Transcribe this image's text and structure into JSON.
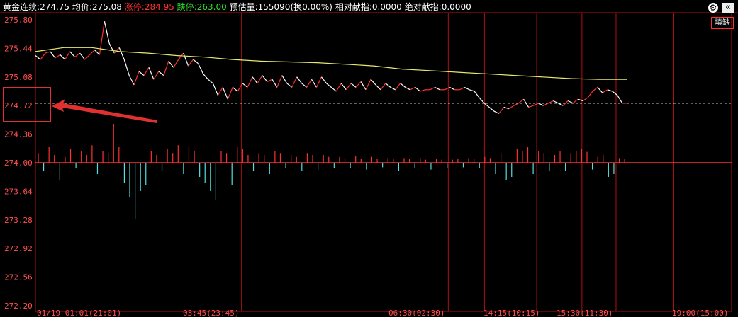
{
  "header": {
    "name": "黄金连续",
    "price": "274.75",
    "avg_label": "均价",
    "avg": "275.08",
    "limit_up_label": "涨停",
    "limit_up": "284.95",
    "limit_down_label": "跌停",
    "limit_down": "263.00",
    "volume_label": "预估量",
    "volume": "155090",
    "turnover": "(换0.00%)",
    "rel_index_label": "相对献指",
    "rel_index": "0.0000",
    "abs_index_label": "绝对献指",
    "abs_index": "0.0000"
  },
  "buttons": {
    "settings": "⚙",
    "collapse": "«",
    "fill_gap": "填缺"
  },
  "colors": {
    "up": "#ff3030",
    "down": "#50e0e0",
    "avg_line": "#e8e870",
    "grid": "#b01010",
    "axis_text": "#ff5050",
    "base_line": "#ff3030",
    "ref_line": "#ffffff",
    "annotation": "#e03030"
  },
  "chart_data": {
    "type": "line",
    "ylim": [
      272.2,
      275.8
    ],
    "y_ticks": [
      "275.80",
      "275.44",
      "275.08",
      "274.72",
      "274.36",
      "274.00",
      "273.64",
      "273.28",
      "272.92",
      "272.56",
      "272.20"
    ],
    "base_value": 274.0,
    "reference_price": 274.75,
    "x_labels": [
      "01/19 01:01(21:01)",
      "03:45(23:45)",
      "06:30(02:30)",
      "14:15(10:15)",
      "15:30(11:30)",
      "19:00(15:00)"
    ],
    "price_series": [
      275.35,
      275.3,
      275.38,
      275.4,
      275.32,
      275.36,
      275.3,
      275.4,
      275.33,
      275.38,
      275.3,
      275.36,
      275.42,
      275.36,
      275.78,
      275.5,
      275.38,
      275.45,
      275.3,
      275.1,
      274.98,
      275.15,
      275.1,
      275.2,
      275.05,
      275.15,
      275.1,
      275.28,
      275.2,
      275.3,
      275.38,
      275.22,
      275.3,
      275.25,
      275.12,
      275.05,
      275.0,
      274.85,
      274.95,
      274.8,
      274.95,
      274.9,
      275.0,
      274.95,
      275.08,
      275.0,
      275.1,
      275.02,
      275.05,
      274.95,
      275.1,
      275.0,
      274.95,
      275.08,
      275.0,
      274.95,
      275.05,
      274.95,
      275.08,
      275.0,
      274.95,
      274.9,
      275.0,
      274.92,
      275.0,
      274.95,
      275.02,
      274.92,
      275.05,
      274.98,
      274.92,
      275.0,
      274.95,
      274.92,
      275.0,
      274.95,
      274.92,
      274.95,
      274.9,
      274.92,
      274.92,
      274.95,
      274.92,
      274.92,
      274.95,
      274.92,
      274.92,
      274.95,
      274.92,
      274.9,
      274.82,
      274.75,
      274.7,
      274.65,
      274.62,
      274.7,
      274.68,
      274.72,
      274.75,
      274.8,
      274.7,
      274.72,
      274.75,
      274.72,
      274.75,
      274.78,
      274.75,
      274.72,
      274.78,
      274.75,
      274.8,
      274.78,
      274.82,
      274.9,
      274.95,
      274.88,
      274.92,
      274.9,
      274.85,
      274.75,
      274.75
    ],
    "avg_series": [
      275.4,
      275.45,
      275.45,
      275.4,
      275.38,
      275.35,
      275.33,
      275.3,
      275.28,
      275.27,
      275.26,
      275.24,
      275.22,
      275.18,
      275.16,
      275.14,
      275.12,
      275.1,
      275.08,
      275.06,
      275.05,
      275.05
    ],
    "avg_series_end_fraction": 0.85,
    "volume_series": [
      0.25,
      -0.15,
      0.4,
      0.2,
      -0.3,
      0.15,
      0.35,
      -0.1,
      0.3,
      0.2,
      0.45,
      -0.2,
      0.3,
      0.25,
      1.0,
      0.4,
      -0.35,
      -0.6,
      -1.0,
      -0.5,
      -0.4,
      0.3,
      0.2,
      -0.15,
      0.35,
      0.25,
      0.45,
      -0.2,
      0.4,
      0.3,
      -0.25,
      -0.35,
      -0.5,
      -0.65,
      0.3,
      0.25,
      -0.4,
      0.4,
      0.35,
      0.2,
      -0.15,
      0.25,
      0.2,
      -0.2,
      0.3,
      0.25,
      -0.1,
      0.2,
      0.15,
      -0.15,
      0.25,
      0.2,
      -0.12,
      0.2,
      0.15,
      -0.1,
      0.15,
      0.12,
      -0.1,
      0.18,
      0.1,
      -0.12,
      0.15,
      0.1,
      -0.08,
      0.12,
      0.1,
      -0.15,
      0.12,
      0.1,
      -0.1,
      0.12,
      0.08,
      -0.12,
      0.1,
      0.08,
      -0.1,
      0.08,
      0.1,
      -0.08,
      0.12,
      0.1,
      -0.1,
      0.15,
      0.12,
      -0.2,
      0.25,
      -0.3,
      -0.25,
      0.35,
      0.3,
      0.4,
      -0.2,
      0.3,
      0.25,
      -0.15,
      0.2,
      0.3,
      -0.15,
      0.25,
      0.3,
      0.35,
      0.28,
      -0.12,
      0.15,
      0.2,
      -0.25,
      -0.2,
      0.12,
      0.1
    ]
  }
}
